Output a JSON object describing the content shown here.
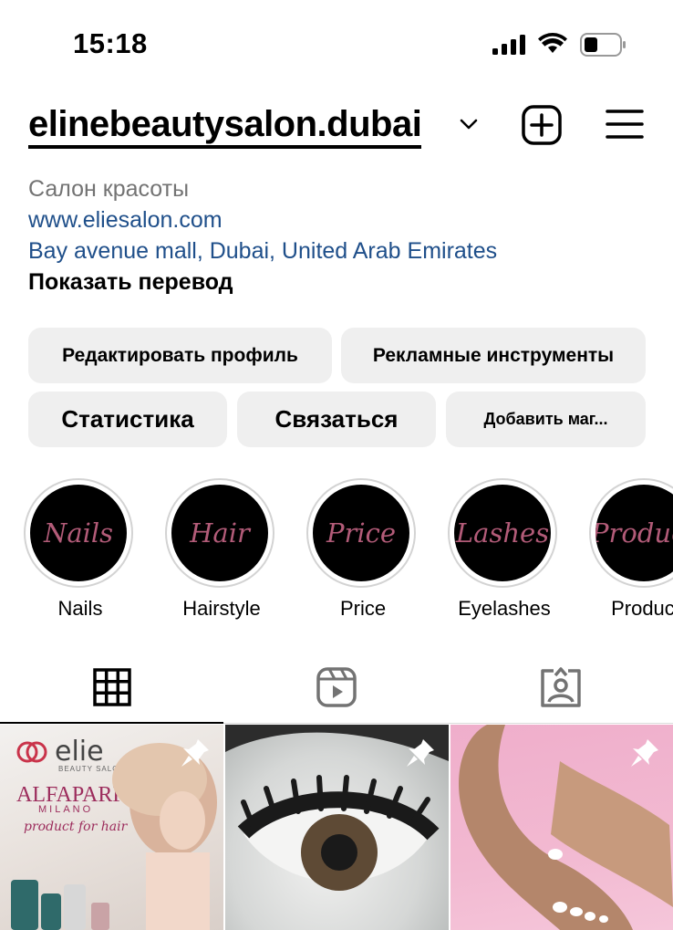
{
  "status_bar": {
    "time": "15:18"
  },
  "header": {
    "username": "elinebeautysalon.dubai"
  },
  "bio": {
    "category": "Салон красоты",
    "website": "www.eliesalon.com",
    "address": "Bay avenue mall, Dubai, United Arab Emirates",
    "translate": "Показать перевод"
  },
  "buttons": {
    "edit_profile": "Редактировать профиль",
    "ad_tools": "Рекламные инструменты",
    "statistics": "Статистика",
    "contact": "Связаться",
    "add_shop": "Добавить маг..."
  },
  "highlights": [
    {
      "cover_text": "Nails",
      "label": "Nails"
    },
    {
      "cover_text": "Hair",
      "label": "Hairstyle"
    },
    {
      "cover_text": "Price",
      "label": "Price"
    },
    {
      "cover_text": "Lashes",
      "label": "Eyelashes"
    },
    {
      "cover_text": "Product",
      "label": "Product"
    }
  ],
  "tabs": [
    {
      "icon": "grid-icon",
      "active": true
    },
    {
      "icon": "reels-icon",
      "active": false
    },
    {
      "icon": "tagged-icon",
      "active": false
    }
  ],
  "posts": [
    {
      "pinned": true,
      "brand": "elie",
      "brand_sub": "BEAUTY SALON",
      "line1": "ALFAPARF",
      "line2": "MILANO",
      "line3": "product for hair"
    },
    {
      "pinned": true
    },
    {
      "pinned": true
    }
  ],
  "colors": {
    "link": "#1f4f8a",
    "secondary_text": "#737373",
    "button_bg": "#efefef",
    "highlight_text": "#b25b78"
  }
}
